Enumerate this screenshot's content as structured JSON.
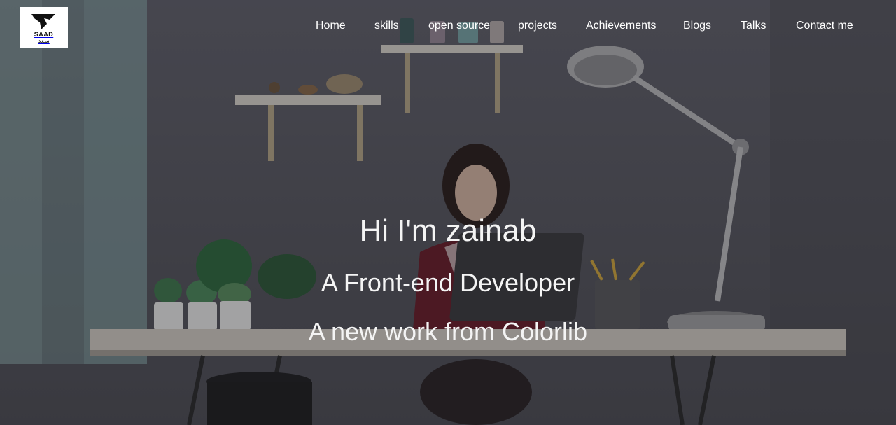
{
  "logo": {
    "text": "SAAD",
    "subtext": "سعد"
  },
  "nav": {
    "items": [
      "Home",
      "skills",
      "open source",
      "projects",
      "Achievements",
      "Blogs",
      "Talks",
      "Contact me"
    ]
  },
  "hero": {
    "greeting": "Hi I'm zainab",
    "role": "A Front-end Developer",
    "tagline": "A new work from Colorlib"
  }
}
